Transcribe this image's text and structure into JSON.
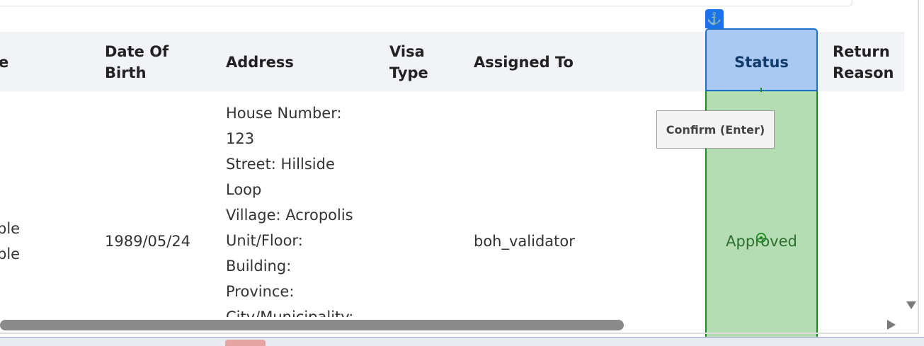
{
  "table": {
    "headers": {
      "name_partial": "e",
      "dob": [
        "Date Of",
        "Birth"
      ],
      "address": "Address",
      "visa_type": [
        "Visa",
        "Type"
      ],
      "assigned_to": "Assigned To",
      "status": "Status",
      "return_reason": [
        "Return",
        "Reason"
      ]
    },
    "row": {
      "name_partial": [
        "ple",
        "ple"
      ],
      "dob": "1989/05/24",
      "address_lines": [
        "House Number:",
        "123",
        "Street: Hillside",
        "Loop",
        "Village: Acropolis",
        "Unit/Floor:",
        "Building:",
        "Province:",
        "City/Municipality:"
      ],
      "assigned_to": "boh_validator",
      "status": "Approved"
    }
  },
  "tooltip": {
    "label": "Confirm (Enter)"
  },
  "icons": {
    "anchor": "anchor-icon",
    "anchor_glyph": "⚓",
    "target": "target-icon",
    "scroll_right": "scroll-right-arrow-icon",
    "scroll_down": "scroll-down-arrow-icon"
  },
  "colors": {
    "status_header_fill": "#a9c9f2",
    "status_header_border": "#1f6fd1",
    "status_column_fill": "#b4ddb4",
    "status_column_border": "#1f8a1f",
    "header_band": "#f2f3f7"
  }
}
